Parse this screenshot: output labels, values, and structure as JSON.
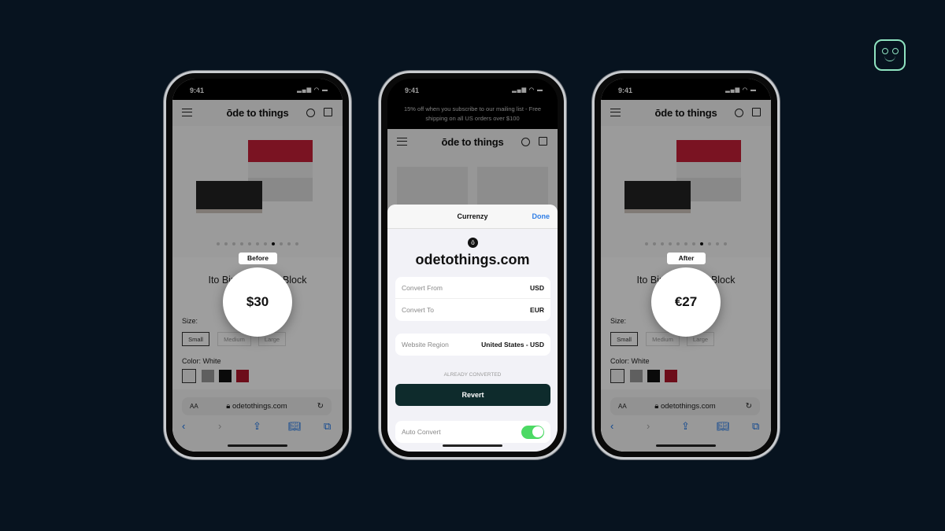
{
  "brand_color": "#8fe3c0",
  "status": {
    "time": "9:41",
    "icons": "signal wifi battery"
  },
  "store": {
    "logo": "ōde to things",
    "menu_icon": "hamburger-icon",
    "search_icon": "search-icon",
    "cart_icon": "bag-icon"
  },
  "product": {
    "title": "Ito Binary Memo Block",
    "size_label": "Size:",
    "sizes": [
      "Small",
      "Medium",
      "Large"
    ],
    "color_label": "Color: White",
    "swatches": [
      "#f2f2f2",
      "#9a9a9a",
      "#111111",
      "#b0152b"
    ]
  },
  "browser": {
    "text_size": "AA",
    "url": "odetothings.com"
  },
  "before": {
    "badge": "Before",
    "price": "$30"
  },
  "after": {
    "badge": "After",
    "price": "€27"
  },
  "middle": {
    "banner": "15% off when you subscribe to our mailing list - Free shipping on all US orders over $100",
    "sheet_title": "Currenzy",
    "done": "Done",
    "site_icon_letter": "ō",
    "domain": "odetothings.com",
    "convert_from_label": "Convert From",
    "convert_from": "USD",
    "convert_to_label": "Convert To",
    "convert_to": "EUR",
    "region_label": "Website Region",
    "region": "United States - USD",
    "status": "ALREADY CONVERTED",
    "revert": "Revert",
    "auto_convert_label": "Auto Convert",
    "auto_convert_on": true
  }
}
